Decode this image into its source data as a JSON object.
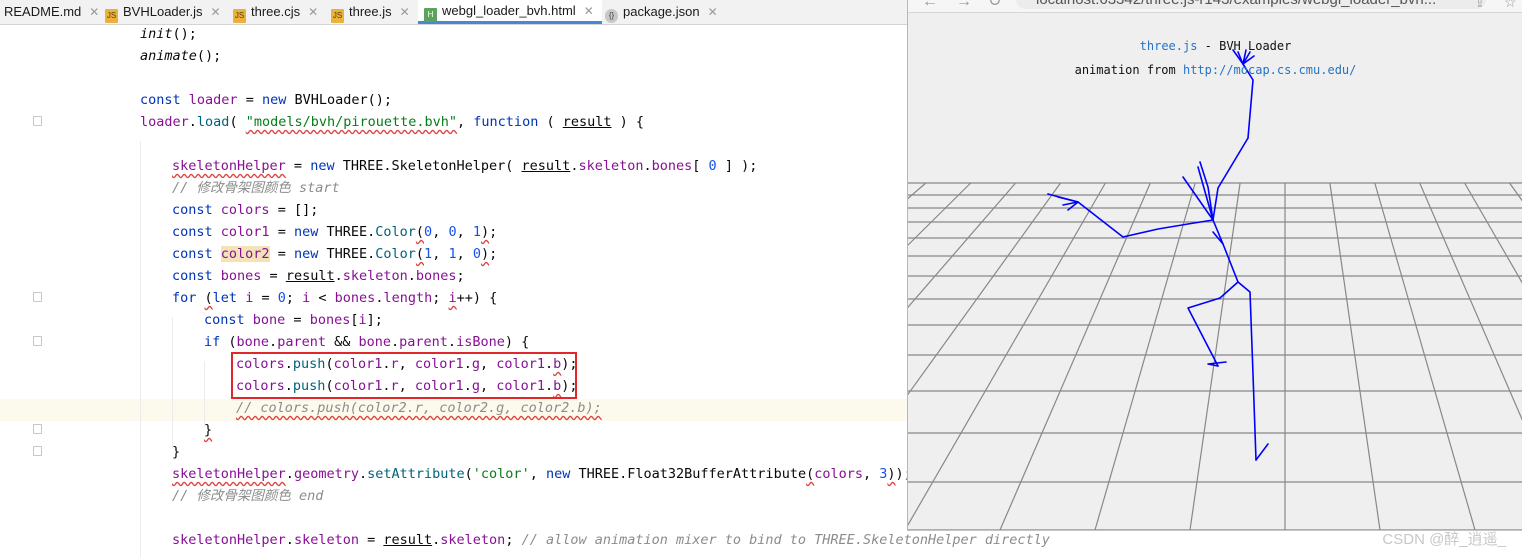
{
  "tabs": [
    {
      "name": "README.md",
      "icon": "markdown-file-icon",
      "type": "md"
    },
    {
      "name": "BVHLoader.js",
      "icon": "js-file-icon",
      "type": "js"
    },
    {
      "name": "three.cjs",
      "icon": "js-file-icon",
      "type": "js"
    },
    {
      "name": "three.js",
      "icon": "js-file-icon",
      "type": "js"
    },
    {
      "name": "webgl_loader_bvh.html",
      "icon": "html-file-icon",
      "type": "html",
      "active": true
    },
    {
      "name": "package.json",
      "icon": "json-file-icon",
      "type": "json"
    }
  ],
  "code": {
    "l1": "init",
    "l2": "animate",
    "l4_kw": "const",
    "l4_var": "loader",
    "l4_new": "new",
    "l4_cls": "BVHLoader",
    "l5_obj": "loader",
    "l5_fn": "load",
    "l5_str": "\"models/bvh/pirouette.bvh\"",
    "l5_kw": "function",
    "l5_param": "result",
    "l7_var": "skeletonHelper",
    "l7_new": "new",
    "l7_cls": "THREE.SkeletonHelper",
    "l7_arg": "result",
    "l7_prop": "skeleton",
    "l7_prop2": "bones",
    "l7_idx": "0",
    "l8_comment": "// 修改骨架图颜色 start",
    "l9_kw": "const",
    "l9_var": "colors",
    "l10_kw": "const",
    "l10_var": "color1",
    "l10_new": "new",
    "l10_cls": "THREE.",
    "l10_fn": "Color",
    "l10_a": "0",
    "l10_b": "0",
    "l10_c": "1",
    "l11_kw": "const",
    "l11_var": "color2",
    "l11_new": "new",
    "l11_cls": "THREE.",
    "l11_fn": "Color",
    "l11_a": "1",
    "l11_b": "1",
    "l11_c": "0",
    "l12_kw": "const",
    "l12_var": "bones",
    "l12_obj": "result",
    "l12_prop": "skeleton",
    "l12_prop2": "bones",
    "l13_kw": "for",
    "l13_let": "let",
    "l13_i": "i",
    "l13_zero": "0",
    "l13_i2": "i",
    "l13_arr": "bones",
    "l13_len": "length",
    "l13_i3": "i",
    "l14_kw": "const",
    "l14_var": "bone",
    "l14_arr": "bones",
    "l14_i": "i",
    "l15_kw": "if",
    "l15_a": "bone",
    "l15_pa": "parent",
    "l15_b": "bone",
    "l15_pb": "parent",
    "l15_pc": "isBone",
    "l16_obj": "colors",
    "l16_fn": "push",
    "l16_a": "color1",
    "l16_ar": "r",
    "l16_b": "color1",
    "l16_bg": "g",
    "l16_c": "color1",
    "l16_cb": "b",
    "l18_comment": "// colors.push(color2.r, color2.g, color2.b);",
    "l21_obj": "skeletonHelper",
    "l21_p1": "geometry",
    "l21_fn": "setAttribute",
    "l21_str": "'color'",
    "l21_new": "new",
    "l21_cls": "THREE.Float32BufferAttribute",
    "l21_arg": "colors",
    "l21_num": "3",
    "l22_comment": "// 修改骨架图颜色 end",
    "l24_obj": "skeletonHelper",
    "l24_p": "skeleton",
    "l24_v": "result",
    "l24_p2": "skeleton",
    "l24_comment": "// allow animation mixer to bind to THREE.SkeletonHelper directly"
  },
  "browser": {
    "url": "localhost:63342/three.js-r143/examples/webgl_loader_bvh...",
    "info_link": "three.js",
    "info_title": " - BVH Loader",
    "info_line2_prefix": "animation from ",
    "info_line2_link": "http://mocap.cs.cmu.edu/",
    "skeleton_color": "#0000ff",
    "grid_color": "#888888"
  },
  "watermark": "CSDN @醉_逍遥_"
}
